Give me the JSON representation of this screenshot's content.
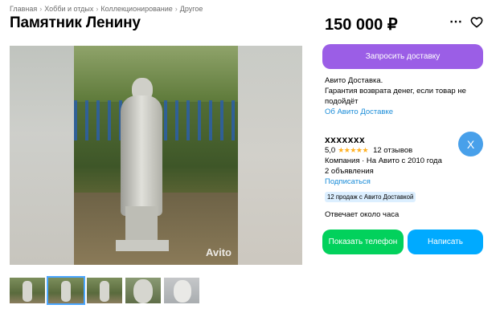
{
  "breadcrumb": {
    "items": [
      "Главная",
      "Хобби и отдых",
      "Коллекционирование",
      "Другое"
    ],
    "separator": "›"
  },
  "listing": {
    "title": "Памятник Ленину",
    "price": "150 000 ₽",
    "watermark": "Avito"
  },
  "actions": {
    "more_icon": "more-dots-icon",
    "favorite_icon": "heart-icon",
    "delivery_button": "Запросить доставку",
    "phone_button": "Показать телефон",
    "message_button": "Написать"
  },
  "delivery_info": {
    "line1": "Авито Доставка.",
    "line2": "Гарантия возврата денег, если товар не подойдёт",
    "link": "Об Авито Доставке"
  },
  "seller": {
    "name": "xxxxxxx",
    "avatar_letter": "X",
    "rating": "5,0",
    "stars": "★★★★★",
    "reviews": "12 отзывов",
    "company": "Компания · На Авито с 2010 года",
    "ads_count": "2 объявления",
    "subscribe": "Подписаться",
    "sales_badge": "12 продаж с Авито Доставкой",
    "response_time": "Отвечает около часа"
  },
  "gallery": {
    "thumbnail_count": 5,
    "active_thumbnail": 2
  },
  "colors": {
    "delivery_button": "#9b5ee6",
    "phone_button": "#02d15c",
    "message_button": "#00aaff",
    "avatar": "#48a0ea",
    "link": "#1a8cd8",
    "stars": "#ffb021"
  }
}
